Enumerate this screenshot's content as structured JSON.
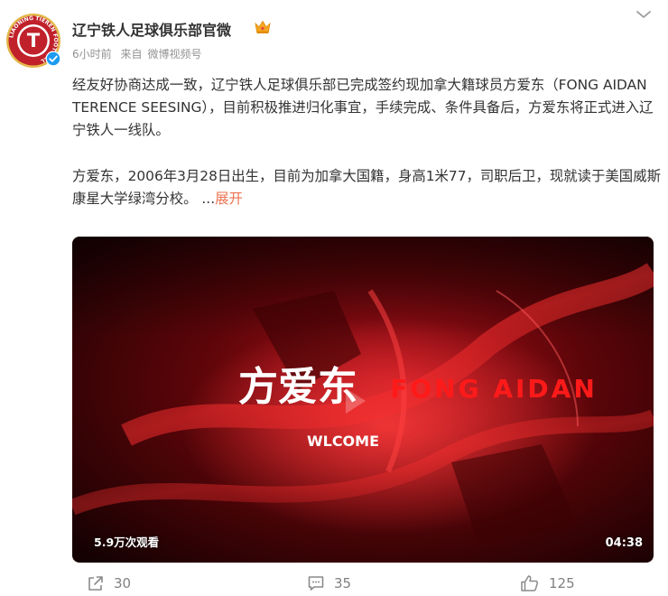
{
  "post": {
    "author": "辽宁铁人足球俱乐部官微",
    "avatar_text": "LIAONING TIEREN FOOTBALL",
    "avatar_letter": "T",
    "time": "6小时前",
    "source_prefix": "来自",
    "source": "微博视频号",
    "paragraphs": [
      "经友好协商达成一致，辽宁铁人足球俱乐部已完成签约现加拿大籍球员方爱东（FONG AIDAN TERENCE SEESING），目前积极推进归化事宜，手续完成、条件具备后，方爱东将正式进入辽宁铁人一线队。",
      "方爱东，2006年3月28日出生，目前为加拿大国籍，身高1米77，司职后卫，现就读于美国威斯康星大学绿湾分校。 ..."
    ],
    "expand_label": "展开"
  },
  "video": {
    "title_cn": "方爱东",
    "title_en": "FONG AIDAN",
    "subtitle": "WLCOME",
    "views": "5.9万次观看",
    "duration": "04:38"
  },
  "actions": {
    "share_count": "30",
    "comment_count": "35",
    "like_count": "125"
  },
  "icons": [
    "more-icon",
    "verified-icon",
    "crown-icon",
    "share-icon",
    "comment-icon",
    "like-icon"
  ],
  "colors": {
    "accent": "#eb7350",
    "verified": "#1d9bf0",
    "video_red": "#c8101c"
  }
}
